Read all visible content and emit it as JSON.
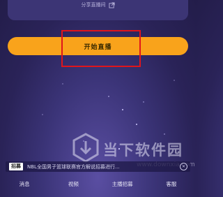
{
  "top": {
    "share_label": "分享直播间",
    "share_icon": "external-link-icon"
  },
  "main": {
    "start_button_label": "开始直播"
  },
  "notice": {
    "tag": "招募",
    "text": "NBL全国男子篮球联赛官方解说招募进行..."
  },
  "nav": {
    "items": [
      {
        "label": "消息"
      },
      {
        "label": "视频"
      },
      {
        "label": "主播招募"
      },
      {
        "label": "客服"
      }
    ]
  },
  "watermark": {
    "title": "当下软件园",
    "url": "www.downxia.com"
  },
  "colors": {
    "accent": "#f9a31b",
    "background": "#2a2358",
    "highlight": "#e0151b"
  }
}
